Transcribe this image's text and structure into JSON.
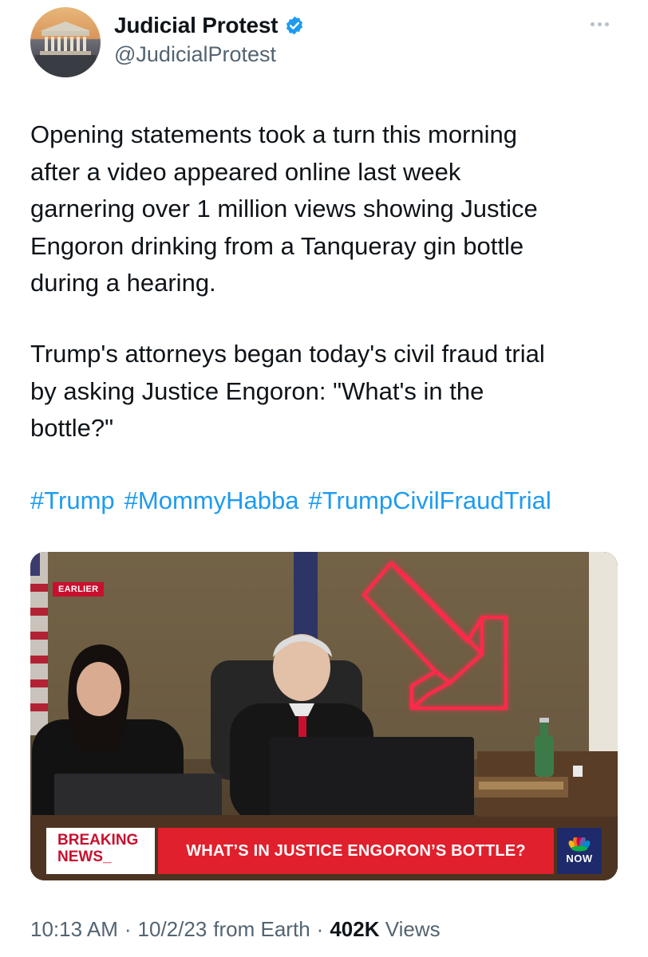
{
  "author": {
    "display_name": "Judicial Protest",
    "handle": "@JudicialProtest",
    "verified": true,
    "avatar_icon": "supreme-court-building-avatar"
  },
  "tweet": {
    "paragraph1": "Opening statements took a turn this morning\nafter a video appeared online last week\ngarnering over 1 million views showing Justice\nEngoron drinking from a Tanqueray gin bottle\nduring a hearing.",
    "paragraph2": "Trump's attorneys began today's civil fraud trial\nby asking Justice Engoron:  \"What's in the\nbottle?\"",
    "hashtags": [
      "#Trump",
      "#MommyHabba",
      "#TrumpCivilFraudTrial"
    ]
  },
  "media": {
    "earlier_tag": "EARLIER",
    "breaking_line1": "BREAKING",
    "breaking_line2": "NEWS_",
    "headline": "WHAT’S IN JUSTICE ENGORON’S BOTTLE?",
    "network_badge": "NOW",
    "arrow_color": "#ff2a4a",
    "banner_color": "#e0202c"
  },
  "meta": {
    "time": "10:13 AM",
    "separator": "·",
    "date": "10/2/23",
    "source": "from Earth",
    "views_count": "402K",
    "views_label": "Views"
  },
  "colors": {
    "link": "#1d9bf0",
    "secondary_text": "#536471",
    "verified_badge": "#1d9bf0"
  }
}
